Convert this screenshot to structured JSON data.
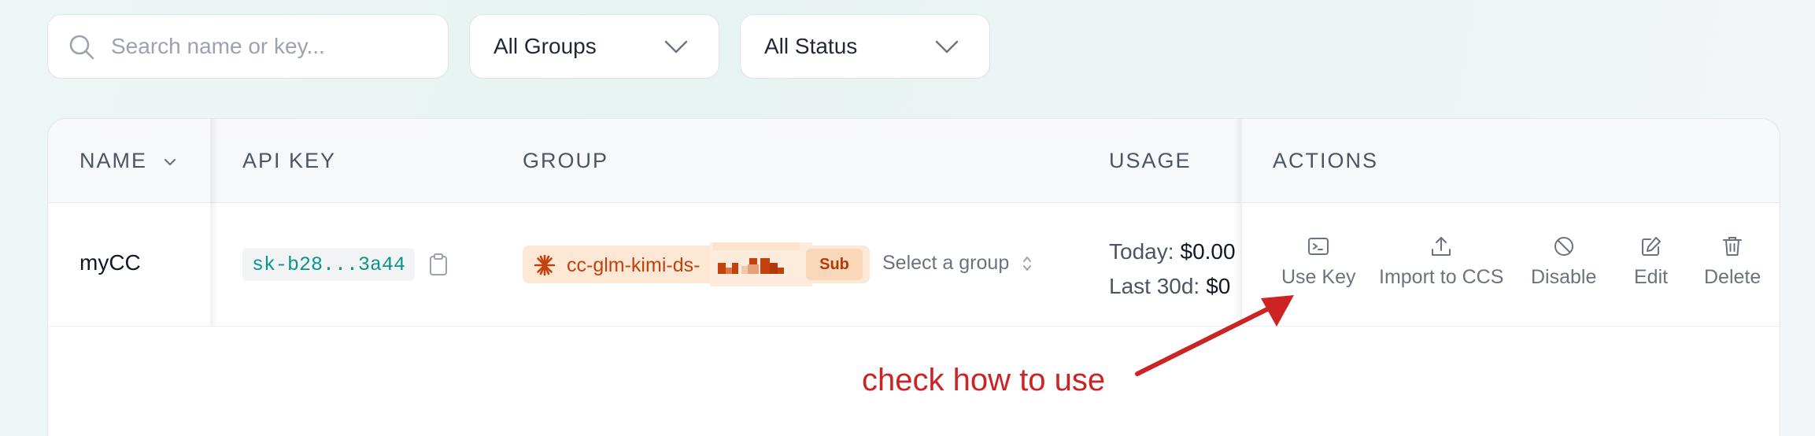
{
  "filters": {
    "search_placeholder": "Search name or key...",
    "groups_value": "All Groups",
    "status_value": "All Status"
  },
  "table": {
    "headers": {
      "name": "NAME",
      "api_key": "API KEY",
      "group": "GROUP",
      "usage": "USAGE",
      "actions": "ACTIONS"
    },
    "rows": [
      {
        "name": "myCC",
        "api_key": "sk-b28...3a44",
        "group_name": "cc-glm-kimi-ds-",
        "group_badge": "Sub",
        "group_select": "Select a group",
        "usage_today_label": "Today:",
        "usage_today_value": "$0.00",
        "usage_30d_label": "Last 30d:",
        "usage_30d_value": "$0"
      }
    ],
    "actions": {
      "use_key": "Use Key",
      "import": "Import to CCS",
      "disable": "Disable",
      "edit": "Edit",
      "delete": "Delete"
    }
  },
  "annotation": {
    "text": "check how to use",
    "color": "#cc2424"
  },
  "colors": {
    "accent_teal": "#0d9488",
    "group_orange": "#c2410c",
    "group_bg": "#fde8d6"
  }
}
